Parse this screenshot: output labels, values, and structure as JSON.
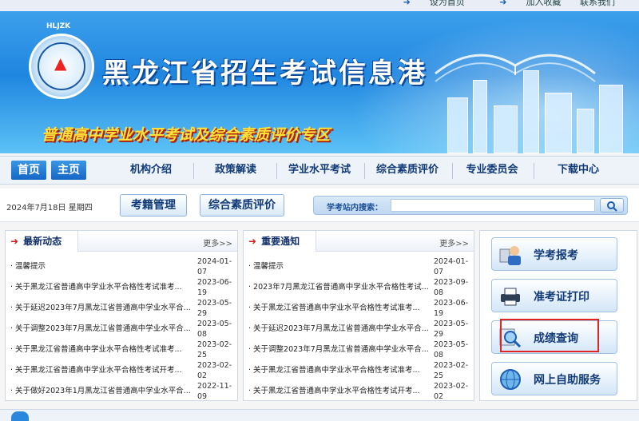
{
  "topbar": {
    "links": [
      "设为首页",
      "加入收藏",
      "联系我们"
    ]
  },
  "banner": {
    "logo_tag": "HLJZK",
    "title": "黑龙江省招生考试信息港",
    "subtitle": "普通高中学业水平考试及综合素质评价专区"
  },
  "nav": {
    "home_cn": "首页",
    "home2": "主页",
    "items": [
      "机构介绍",
      "政策解读",
      "学业水平考试",
      "综合素质评价",
      "专业委员会",
      "下载中心"
    ]
  },
  "toolbar": {
    "date": "2024年7月18日  星期四",
    "btn_status": "考籍管理",
    "btn_eval": "综合素质评价",
    "search_label": "学考站内搜索：",
    "search_placeholder": ""
  },
  "panel_news": {
    "title": "最新动态",
    "more": "更多>>",
    "rows": [
      {
        "t": "· 温馨提示",
        "d": "2024-01-07"
      },
      {
        "t": "· 关于黑龙江省普通高中学业水平合格性考试准考...",
        "d": "2023-06-19"
      },
      {
        "t": "· 关于延迟2023年7月黑龙江省普通高中学业水平合...",
        "d": "2023-05-29"
      },
      {
        "t": "· 关于调整2023年7月黑龙江省普通高中学业水平合...",
        "d": "2023-05-08"
      },
      {
        "t": "· 关于黑龙江省普通高中学业水平合格性考试准考...",
        "d": "2023-02-25"
      },
      {
        "t": "· 关于黑龙江省普通高中学业水平合格性考试开考...",
        "d": "2023-02-02"
      },
      {
        "t": "· 关于做好2023年1月黑龙江省普通高中学业水平合...",
        "d": "2022-11-09"
      }
    ]
  },
  "panel_notice": {
    "title": "重要通知",
    "more": "更多>>",
    "rows": [
      {
        "t": "· 温馨提示",
        "d": "2024-01-07"
      },
      {
        "t": "· 2023年7月黑龙江省普通高中学业水平合格性考试...",
        "d": "2023-09-08"
      },
      {
        "t": "· 关于黑龙江省普通高中学业水平合格性考试准考...",
        "d": "2023-06-19"
      },
      {
        "t": "· 关于延迟2023年7月黑龙江省普通高中学业水平合...",
        "d": "2023-05-29"
      },
      {
        "t": "· 关于调整2023年7月黑龙江省普通高中学业水平合...",
        "d": "2023-05-08"
      },
      {
        "t": "· 关于黑龙江省普通高中学业水平合格性考试准考...",
        "d": "2023-02-25"
      },
      {
        "t": "· 关于黑龙江省普通高中学业水平合格性考试开考...",
        "d": "2023-02-02"
      }
    ]
  },
  "side": {
    "register": "学考报考",
    "ticket": "准考证打印",
    "score": "成绩查询",
    "self_service": "网上自助服务"
  },
  "colors": {
    "brand_blue": "#1f86e0",
    "highlight_red": "#e02424",
    "nav_text": "#113a78"
  }
}
